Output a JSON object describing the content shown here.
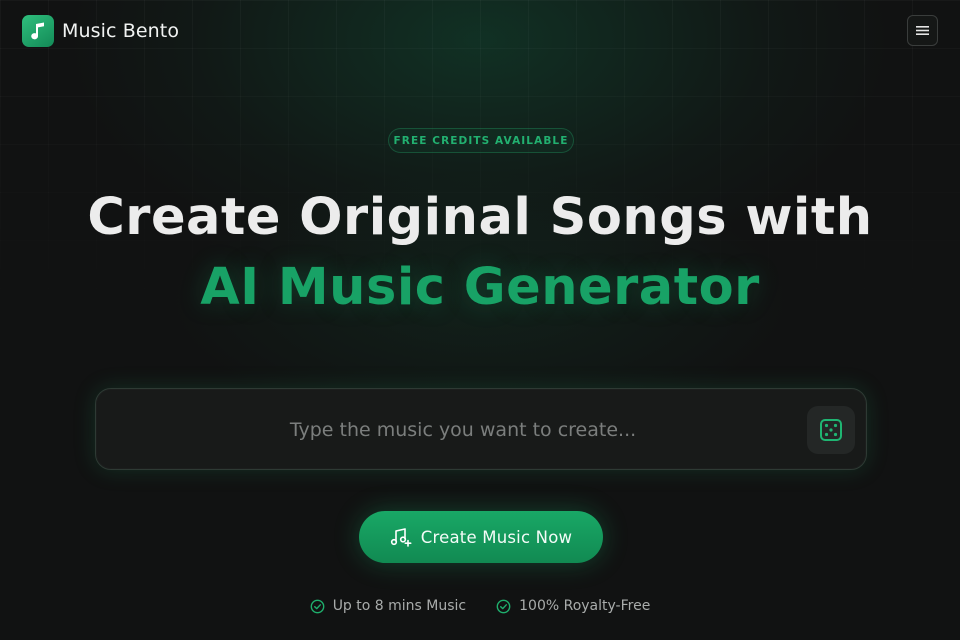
{
  "header": {
    "brand_name": "Music Bento",
    "logo_icon": "music-note-icon",
    "menu_icon": "hamburger-menu-icon"
  },
  "hero": {
    "badge": "FREE CREDITS AVAILABLE",
    "title_line1": "Create Original Songs with",
    "title_line2": "AI Music Generator"
  },
  "prompt": {
    "value": "",
    "placeholder": "Type the music you want to create...",
    "random_icon": "dice-icon"
  },
  "cta": {
    "label": "Create Music Now",
    "icon": "music-plus-icon"
  },
  "features": [
    {
      "label": "Up to 8 mins Music",
      "icon": "check-circle-icon"
    },
    {
      "label": "100% Royalty-Free",
      "icon": "check-circle-icon"
    }
  ],
  "colors": {
    "accent": "#18a266",
    "background": "#111212",
    "badge_text": "#22b070"
  }
}
